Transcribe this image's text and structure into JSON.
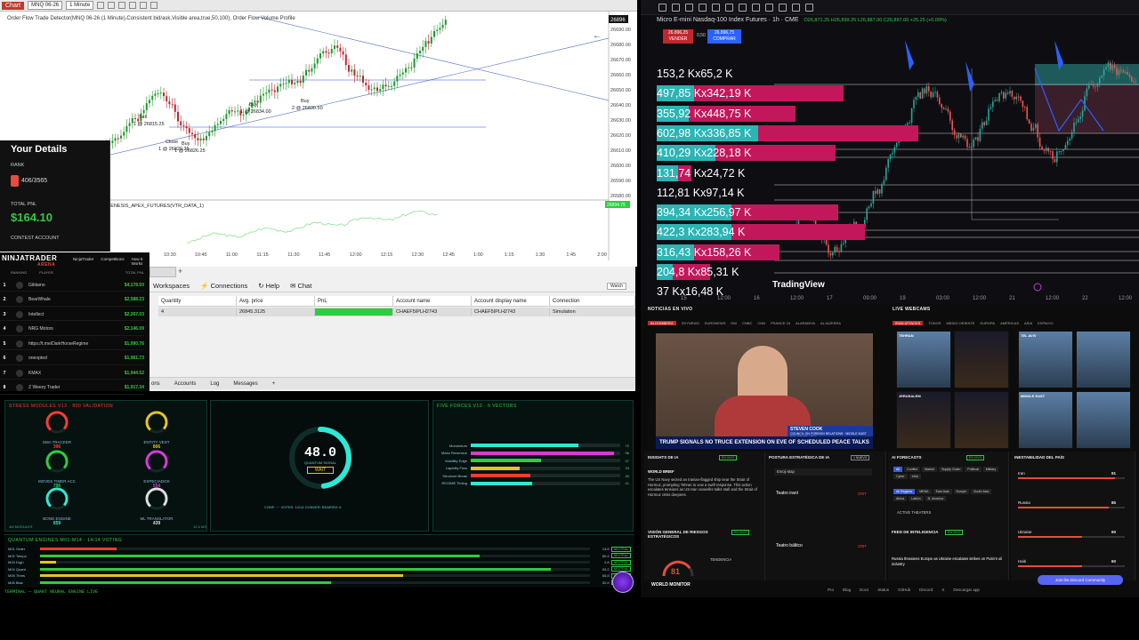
{
  "ninja": {
    "chip": "Chart",
    "instrument": "MNQ 06-26",
    "interval": "1 Minute",
    "info_line": "Order Flow Trade Detector(MNQ 06-26 (1 Minute),Consistent bid/ask,Visible area,true,50,100), Order Flow Volume Profile",
    "indicator_line": "GENESIS_APEX_FUTURES(VTR_DATA_1)",
    "price_badge": "26896",
    "ind_badge": "26894.75",
    "y_ticks": [
      "26690.00",
      "26680.00",
      "26670.00",
      "26660.00",
      "26650.00",
      "26640.00",
      "26630.00",
      "26620.00",
      "26610.00",
      "26600.00",
      "26590.00",
      "26580.00"
    ],
    "x_ticks": [
      "10:30",
      "10:45",
      "11:00",
      "11:15",
      "11:30",
      "11:45",
      "12:00",
      "12:15",
      "12:30",
      "12:45",
      "1:00",
      "1:15",
      "1:30",
      "1:45",
      "2:00"
    ],
    "annotations": {
      "sell": "Sell",
      "sell_fill": "1 @ 26815.25",
      "close": "Close",
      "close_fill": "1 @ 26820.25",
      "buy1": "Buy",
      "buy1_fill": "1 @ 26826.25",
      "buy2": "Buy",
      "buy2_fill": "1 @ 26834.00",
      "buy3": "Buy",
      "buy3_fill": "2 @ 26830.50"
    }
  },
  "details": {
    "title": "Your Details",
    "rank_label": "RANK",
    "rank_value": "406/3565",
    "pnl_label": "TOTAL PNL",
    "pnl_value": "$164.10",
    "contest_label": "CONTEST ACCOUNT"
  },
  "leaderboard": {
    "brand": "NINJATRADER",
    "brand_sub": "ARENA",
    "tabs": [
      "NinjaTrader",
      "Competitions",
      "How It Works"
    ],
    "cols": [
      "RANKING",
      "PLAYER",
      "TOTAL PNL"
    ],
    "rows": [
      {
        "rank": "1",
        "name": "Gildamo",
        "pnl": "$4,178.50"
      },
      {
        "rank": "2",
        "name": "BearWhale",
        "pnl": "$2,588.23"
      },
      {
        "rank": "3",
        "name": "Intellect",
        "pnl": "$2,267.03"
      },
      {
        "rank": "4",
        "name": "NRG Motors",
        "pnl": "$2,146.09"
      },
      {
        "rank": "5",
        "name": "https://t.me/DarkHorseRegime",
        "pnl": "$1,990.76"
      },
      {
        "rank": "6",
        "name": "oneopted",
        "pnl": "$1,961.73"
      },
      {
        "rank": "7",
        "name": "KMAX",
        "pnl": "$1,944.52"
      },
      {
        "rank": "8",
        "name": "Z Weezy Trader",
        "pnl": "$1,917.34"
      }
    ]
  },
  "control": {
    "menu": [
      "Workspaces",
      "Connections",
      "Help",
      "Chat"
    ],
    "watch": "Watch",
    "headers": [
      "Quantity",
      "Avg. price",
      "PnL",
      "Account name",
      "Account display name",
      "Connection"
    ],
    "row": [
      "4",
      "26845.3125",
      "",
      "CHAEF5IPLH2743",
      "CHAEF5IPLH2743",
      "Simulation"
    ],
    "tabs": [
      "ons",
      "Accounts",
      "Log",
      "Messages",
      "+"
    ]
  },
  "gauges": {
    "title": "STRESS MODULES V13 · 800 VALIDATION",
    "items": [
      {
        "label": "SMA TRACKER",
        "value": "396",
        "color": "#ff3b30"
      },
      {
        "label": "ENTITY VEST",
        "value": "806",
        "color": "#e6c229"
      },
      {
        "label": "MOVES TIMER ACC",
        "value": "796",
        "color": "#2ecc40"
      },
      {
        "label": "ESPECIADOS",
        "value": "554",
        "color": "#d63bd6"
      },
      {
        "label": "BOND ENGINE",
        "value": "659",
        "color": "#2ee8d6"
      },
      {
        "label": "ML TRANSLATOR",
        "value": "439",
        "color": "#ddd"
      }
    ],
    "foot_left": "4/6 MODULES",
    "foot_right": "12.4 MS"
  },
  "ring": {
    "value": "48.0",
    "percent": 48,
    "sub": "QUANTUM SIGNAL",
    "badge": "WAIT",
    "foot": "CONF: ··· VOTES: 14/14   CONVER: BEARISH 4:"
  },
  "forces": {
    "title": "FIVE FORCES V10 · 6 VECTORS",
    "items": [
      {
        "label": "Momentum",
        "value": "72",
        "pct": 0.72,
        "color": "#2ee8d6"
      },
      {
        "label": "Mean Reversion",
        "value": "96",
        "pct": 0.96,
        "color": "#d63bd6"
      },
      {
        "label": "Volatility Edge",
        "value": "47",
        "pct": 0.47,
        "color": "#2ecc40"
      },
      {
        "label": "Liquidity Flow",
        "value": "33",
        "pct": 0.33,
        "color": "#e6c229"
      },
      {
        "label": "Structure Break",
        "value": "40",
        "pct": 0.4,
        "color": "#ff3b30"
      },
      {
        "label": "REGIME Timing",
        "value": "41",
        "pct": 0.41,
        "color": "#2ee8d6"
      }
    ]
  },
  "quantum": {
    "title": "QUANTUM ENGINES M01-M14 · 14/14 VOTING",
    "items": [
      {
        "label": "M01 Order",
        "value": "13.6",
        "pct": 0.14,
        "color": "#ff3b30",
        "badge": "NEUTRAL"
      },
      {
        "label": "M02 Tempo",
        "value": "80.4",
        "pct": 0.8,
        "color": "#2ecc40",
        "badge": "NEUTRAL"
      },
      {
        "label": "M03 Drgh",
        "value": "2.8",
        "pct": 0.03,
        "color": "#e6c229",
        "badge": "NEUTRAL"
      },
      {
        "label": "M04 Quant",
        "value": "93.2",
        "pct": 0.93,
        "color": "#2ecc40",
        "badge": "NEUTRAL"
      },
      {
        "label": "M05 Thres",
        "value": "65.8",
        "pct": 0.66,
        "color": "#e6c229",
        "badge": "NEUTRAL"
      },
      {
        "label": "M06 Bias",
        "value": "52.6",
        "pct": 0.53,
        "color": "#2ecc40",
        "badge": "NEUTRAL"
      }
    ]
  },
  "terminal": "TERMINAL — QUANT NEURAL ENGINE LIVE",
  "tv": {
    "symbol": "Micro E-mini Nasdaq-100 Index Futures · 1h · CME",
    "quote": "O26,871.25 H26,899.25 L26,887.00 C26,897.00 +25.25 (+0.09%)",
    "sell_price": "26.896,25",
    "sell_label": "VENDER",
    "mid": "0,50",
    "buy_price": "26.896,75",
    "buy_label": "COMPRAR",
    "logo": "TradingView",
    "x_ticks": [
      "15",
      "12:00",
      "16",
      "12:00",
      "17",
      "09:00",
      "19",
      "03:00",
      "12:00",
      "21",
      "12:00",
      "22",
      "12:00"
    ],
    "profile": [
      {
        "label": "153,2 Kx65,2 K",
        "a": 0.0,
        "b": 0.0
      },
      {
        "label": "497,85 Kx342,19 K",
        "a": 0.14,
        "b": 0.56
      },
      {
        "label": "355,92 Kx448,75 K",
        "a": 0.12,
        "b": 0.4
      },
      {
        "label": "602,98 Kx336,85 K",
        "a": 0.38,
        "b": 0.6
      },
      {
        "label": "410,29 Kx228,18 K",
        "a": 0.22,
        "b": 0.45
      },
      {
        "label": "131,74 Kx24,72 K",
        "a": 0.08,
        "b": 0.05
      },
      {
        "label": "112,81 Kx97,14 K",
        "a": 0.0,
        "b": 0.0
      },
      {
        "label": "394,34 Kx256,97 K",
        "a": 0.28,
        "b": 0.4
      },
      {
        "label": "422,3 Kx283,94 K",
        "a": 0.28,
        "b": 0.5
      },
      {
        "label": "316,43 Kx158,26 K",
        "a": 0.14,
        "b": 0.32
      },
      {
        "label": "204,8 Kx85,31 K",
        "a": 0.06,
        "b": 0.14
      },
      {
        "label": "37 Kx16,48 K",
        "a": 0.0,
        "b": 0.0
      }
    ]
  },
  "wm": {
    "news_title": "NOTICIAS EN VIVO",
    "news_tabs": [
      "BLOOMBERG",
      "SKYNEWS",
      "EURONEWS",
      "DW",
      "CNBC",
      "CNN",
      "FRANCE 24",
      "ALARABIYA",
      "ALJAZEERA"
    ],
    "cams_title": "LIVE WEBCAMS",
    "cams_tabs": [
      "IRAN ATTACKS",
      "TODOS",
      "MEDIO ORIENTE",
      "EUROPA",
      "AMÉRICAS",
      "ASIA",
      "ESPACIO"
    ],
    "cams": [
      "TEHRAN",
      "TEL AVIV",
      "JERUSALEM",
      "MIDDLE EAST"
    ],
    "person": "STEVEN COOK",
    "person_title": "COUNCIL ON FOREIGN RELATIONS · MIDDLE EAST SENIOR FELLOW",
    "banner": "TRUMP SIGNALS NO TRUCE EXTENSION ON EVE OF SCHEDULED PEACE TALKS",
    "insights_title": "INSIGHTS DE IA",
    "insights_badge": "EN VIVO",
    "insights_src": "WORLD BRIEF",
    "insights_text": "The US Navy seized an Iranian-flagged ship near the Strait of Hormuz, prompting Tehran to vow a swift response. This action escalates tensions as US-Iran ceasefire talks stall and the Strait of Hormuz crisis deepens.",
    "risk_title": "VISIÓN GENERAL DE RIESGOS ESTRATÉGICOS",
    "risk_badge": "EN VIVO",
    "risk_value": "81",
    "risk_label": "TENDENCIA",
    "posture_title": "POSTURA ESTRATÉGICA DE IA",
    "posture_badge": "1 NUEVO",
    "posture_sel": "Emoji Map",
    "posture_items": [
      "Teatro iraní",
      "Teatro báltico"
    ],
    "posture_crit": "CRIT",
    "forecast_title": "AI FORECASTS",
    "forecast_badge": "EN VIVO",
    "forecast_pills": [
      "All",
      "Conflict",
      "Market",
      "Supply Chain",
      "Political",
      "Military",
      "Cyber",
      "Infra"
    ],
    "forecast_regions": [
      "All Regions",
      "MENA",
      "East Asia",
      "Europe",
      "South Asia",
      "Africa",
      "LatAm",
      "N. America"
    ],
    "forecast_sub": "ACTIVE THEATERS",
    "feed_title": "FEED DE INTELIGENCIA",
    "feed_badge": "EN VIVO",
    "feed_text": "Russia threatens Europe as Ukraine escalates strikes on Putin's oil industry",
    "instab_title": "INESTABILIDAD DEL PAÍS",
    "instab": [
      {
        "name": "Iran",
        "score": "91",
        "pct": 0.91
      },
      {
        "name": "Russia",
        "score": "85",
        "pct": 0.85
      },
      {
        "name": "Ukraine",
        "score": "60",
        "pct": 0.6
      },
      {
        "name": "Haiti",
        "score": "60",
        "pct": 0.6
      }
    ],
    "brand": "WORLD MONITOR",
    "footer": [
      "Pro",
      "Blog",
      "Docs",
      "Status",
      "GitHub",
      "Discord",
      "X",
      "Descargar app"
    ],
    "discord": "Join the Discord Community"
  }
}
